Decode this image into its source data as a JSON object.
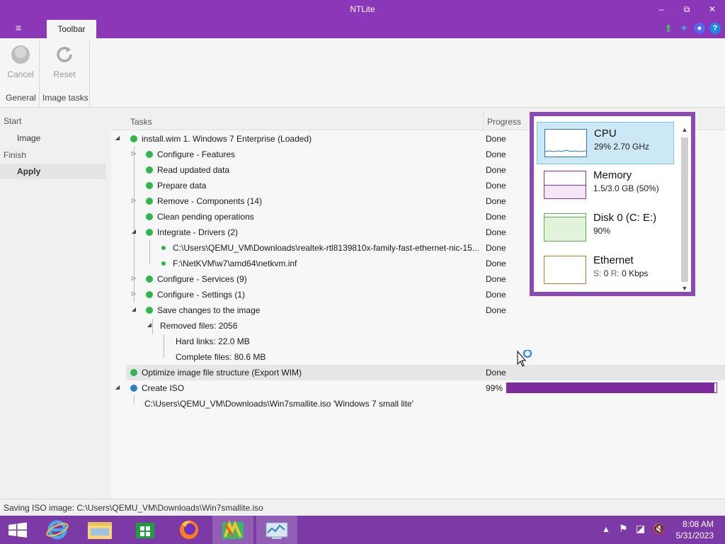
{
  "window": {
    "title": "NTLite"
  },
  "ribbon": {
    "tab_label": "Toolbar",
    "cancel_label": "Cancel",
    "reset_label": "Reset",
    "group_general": "General",
    "group_image_tasks": "Image tasks"
  },
  "nav": {
    "start": "Start",
    "image": "Image",
    "finish": "Finish",
    "apply": "Apply"
  },
  "columns": {
    "tasks": "Tasks",
    "progress": "Progress"
  },
  "tasks": [
    {
      "label": "install.wim 1. Windows 7 Enterprise  (Loaded)",
      "status": "Done"
    },
    {
      "label": "Configure - Features",
      "status": "Done"
    },
    {
      "label": "Read updated data",
      "status": "Done"
    },
    {
      "label": "Prepare data",
      "status": "Done"
    },
    {
      "label": "Remove - Components (14)",
      "status": "Done"
    },
    {
      "label": "Clean pending operations",
      "status": "Done"
    },
    {
      "label": "Integrate - Drivers (2)",
      "status": "Done"
    },
    {
      "label": "C:\\Users\\QEMU_VM\\Downloads\\realtek-rtl8139810x-family-fast-ethernet-nic-15...",
      "status": "Done"
    },
    {
      "label": "F:\\NetKVM\\w7\\amd64\\netkvm.inf",
      "status": "Done"
    },
    {
      "label": "Configure - Services (9)",
      "status": "Done"
    },
    {
      "label": "Configure - Settings (1)",
      "status": "Done"
    },
    {
      "label": "Save changes to the image",
      "status": "Done"
    },
    {
      "label": "Removed files: 2056",
      "status": ""
    },
    {
      "label": "Hard links: 22.0 MB",
      "status": ""
    },
    {
      "label": "Complete files: 80.6 MB",
      "status": ""
    },
    {
      "label": "Optimize image file structure (Export WIM)",
      "status": "Done"
    },
    {
      "label": "Create ISO",
      "status": "99%",
      "progress": 0.99
    },
    {
      "label": "C:\\Users\\QEMU_VM\\Downloads\\Win7smallite.iso 'Windows 7 small lite'",
      "status": ""
    }
  ],
  "perf": {
    "cpu_name": "CPU",
    "cpu_val": "29%  2.70 GHz",
    "mem_name": "Memory",
    "mem_val": "1.5/3.0 GB (50%)",
    "disk_name": "Disk 0 (C: E:)",
    "disk_val": "90%",
    "eth_name": "Ethernet",
    "eth_s_label": "S:",
    "eth_s_val": "0",
    "eth_r_label": "R:",
    "eth_r_val": "0 Kbps"
  },
  "statusbar": {
    "text": "Saving ISO image: C:\\Users\\QEMU_VM\\Downloads\\Win7smallite.iso"
  },
  "taskbar": {
    "time": "8:08 AM",
    "date": "5/31/2023"
  },
  "colors": {
    "accent": "#8a37b8",
    "done_dot": "#2eb84b",
    "running_dot": "#2f7fc5",
    "progress_fill": "#7d2a9f"
  }
}
